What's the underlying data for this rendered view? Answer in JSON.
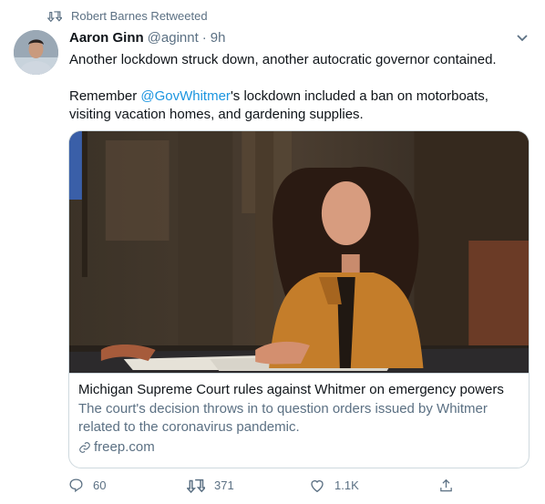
{
  "retweet": {
    "label": "Robert Barnes Retweeted"
  },
  "tweet": {
    "author_name": "Aaron Ginn",
    "handle": "@aginnt",
    "separator": "·",
    "time": "9h",
    "line1": "Another lockdown struck down, another autocratic governor contained.",
    "line2_prefix": "Remember ",
    "mention": "@GovWhitmer",
    "line2_suffix": "'s lockdown included a ban on motorboats, visiting vacation homes, and gardening supplies."
  },
  "card": {
    "title": "Michigan Supreme Court rules against Whitmer on emergency powers",
    "description": "The court's decision throws in to question orders issued by Whitmer related to the coronavirus pandemic.",
    "domain": "freep.com"
  },
  "actions": {
    "reply_count": "60",
    "retweet_count": "371",
    "like_count": "1.1K"
  },
  "colors": {
    "accent": "#1b95e0",
    "secondary_text": "#5b7083"
  },
  "icons": [
    "retweet-icon",
    "chevron-down-icon",
    "link-icon",
    "reply-icon",
    "like-icon",
    "share-icon"
  ]
}
